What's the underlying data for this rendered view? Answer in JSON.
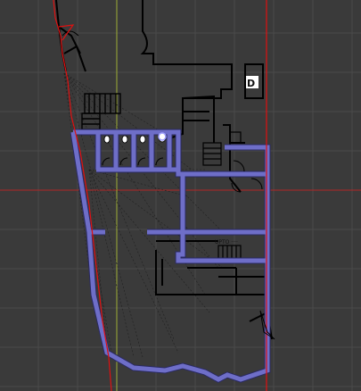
{
  "viewport": {
    "colors": {
      "background": "#3a3a3a",
      "grid": "#4a4a4a",
      "axis_x": "#b32626",
      "axis_y": "#9fae35",
      "plan_lines": "#000000",
      "walls": "#6e6ec8",
      "walls_outline": "#2a2a60",
      "section_red": "#e01010",
      "sightlines": "#202020"
    },
    "labels": {
      "room_marker": "D",
      "stair_note": "UPTO ····"
    },
    "icons": {
      "room_marker": "letter-d-marker-icon",
      "camera": "camera-viewpoint-icon",
      "stair": "staircase-icon",
      "door": "door-swing-icon",
      "toilet": "toilet-fixture-icon"
    }
  }
}
